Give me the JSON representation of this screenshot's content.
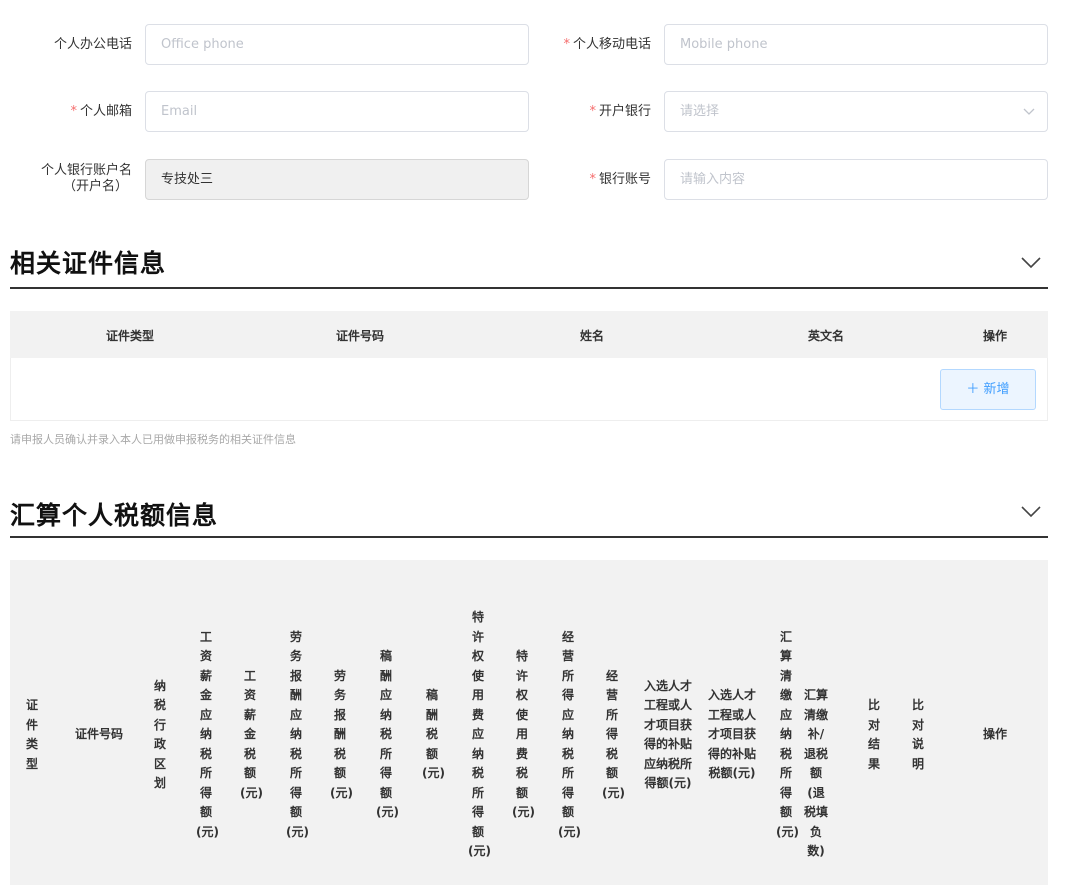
{
  "form": {
    "office_phone": {
      "label": "个人办公电话",
      "placeholder": "Office phone"
    },
    "mobile_phone": {
      "label": "个人移动电话",
      "placeholder": "Mobile phone"
    },
    "email": {
      "label": "个人邮箱",
      "placeholder": "Email"
    },
    "bank": {
      "label": "开户银行",
      "placeholder": "请选择"
    },
    "account_name": {
      "label_line1": "个人银行账户名",
      "label_line2": "（开户名）",
      "value": "专技处三"
    },
    "account_no": {
      "label": "银行账号",
      "placeholder": "请输入内容"
    },
    "required_mark": "*"
  },
  "cert_section": {
    "title": "相关证件信息",
    "columns": [
      "证件类型",
      "证件号码",
      "姓名",
      "英文名",
      "操作"
    ],
    "add_label": "＋ 新增",
    "hint": "请申报人员确认并录入本人已用做申报税务的相关证件信息"
  },
  "tax_section": {
    "title": "汇算个人税额信息",
    "columns": [
      "证件类型",
      "证件号码",
      "纳税行政区划",
      "工资薪金应纳税所得额(元)",
      "工资薪金税额(元)",
      "劳务报酬应纳税所得额(元)",
      "劳务报酬税额(元)",
      "稿酬应纳税所得额(元)",
      "稿酬税额(元)",
      "特许权使用费应纳税所得额(元)",
      "特许权使用费税额(元)",
      "经营所得应纳税所得额(元)",
      "经营所得税额(元)",
      "入选人才工程或人才项目获得的补贴应纳税所得额(元)",
      "入选人才工程或人才项目获得的补贴税额(元)",
      "汇算清缴应纳税所得额(元)",
      "汇算清缴补/退税额(退税填负数)",
      "比对结果",
      "比对说明",
      "操作"
    ]
  },
  "colors": {
    "required": "#f56c6c",
    "primary": "#409eff",
    "header_bg": "#f2f2f2"
  }
}
